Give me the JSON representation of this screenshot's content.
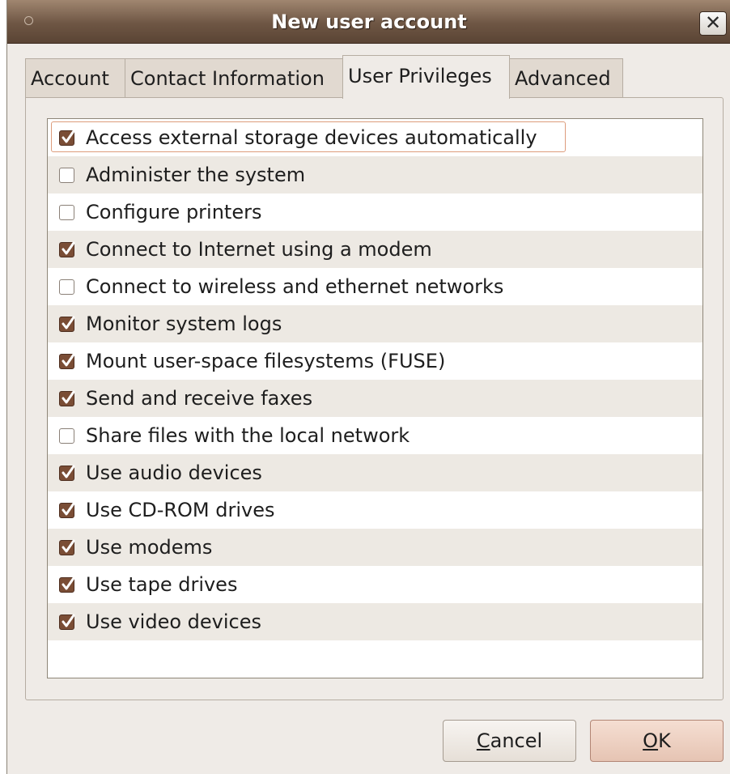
{
  "window": {
    "title": "New user account",
    "close_glyph": "✕"
  },
  "tabs": [
    {
      "label": "Account",
      "active": false
    },
    {
      "label": "Contact Information",
      "active": false
    },
    {
      "label": "User Privileges",
      "active": true
    },
    {
      "label": "Advanced",
      "active": false
    }
  ],
  "privileges": [
    {
      "label": "Access external storage devices automatically",
      "checked": true
    },
    {
      "label": "Administer the system",
      "checked": false
    },
    {
      "label": "Configure printers",
      "checked": false
    },
    {
      "label": "Connect to Internet using a modem",
      "checked": true
    },
    {
      "label": "Connect to wireless and ethernet networks",
      "checked": false
    },
    {
      "label": "Monitor system logs",
      "checked": true
    },
    {
      "label": "Mount user-space filesystems (FUSE)",
      "checked": true
    },
    {
      "label": "Send and receive faxes",
      "checked": true
    },
    {
      "label": "Share files with the local network",
      "checked": false
    },
    {
      "label": "Use audio devices",
      "checked": true
    },
    {
      "label": "Use CD-ROM drives",
      "checked": true
    },
    {
      "label": "Use modems",
      "checked": true
    },
    {
      "label": "Use tape drives",
      "checked": true
    },
    {
      "label": "Use video devices",
      "checked": true
    }
  ],
  "buttons": {
    "cancel": {
      "mnemonic": "C",
      "rest": "ancel"
    },
    "ok": {
      "mnemonic": "O",
      "rest": "K"
    }
  },
  "colors": {
    "titlebar": "#6e5644",
    "checkbox_checked": "#7a4d35",
    "focus_ring": "#dd9c7c"
  }
}
